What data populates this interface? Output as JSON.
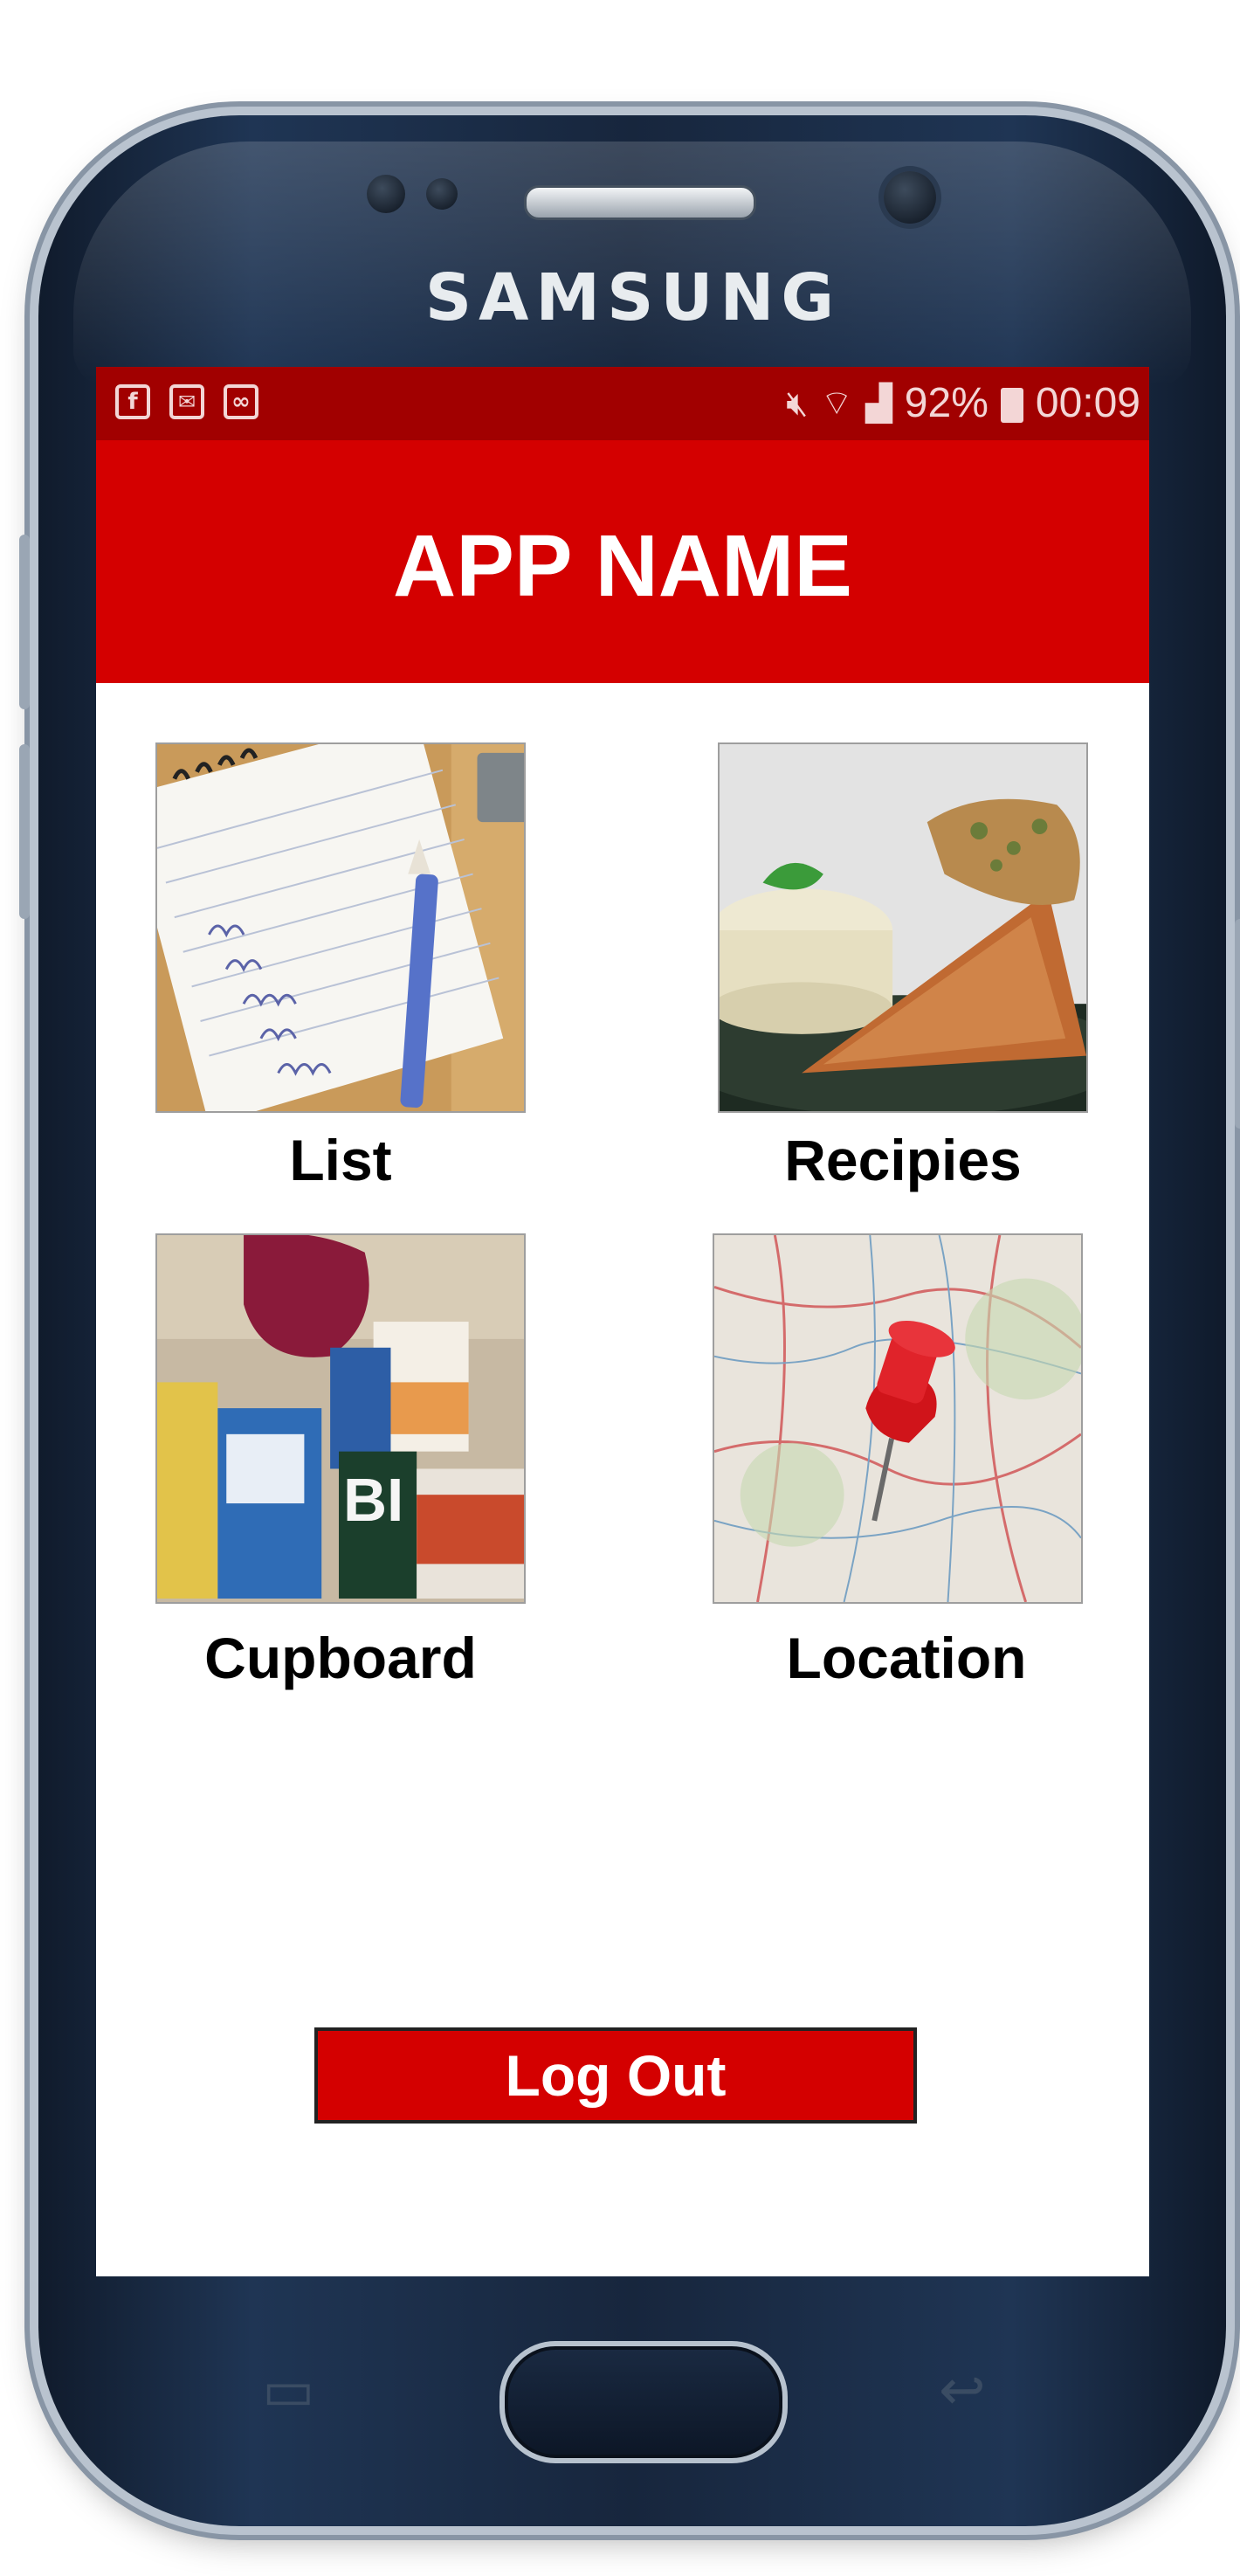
{
  "device": {
    "brand": "SAMSUNG"
  },
  "statusbar": {
    "left_icons": [
      {
        "icon": "facebook-icon",
        "glyph": "f"
      },
      {
        "icon": "mail-icon",
        "glyph": "✉"
      },
      {
        "icon": "voicemail-icon",
        "glyph": "∞"
      }
    ],
    "battery": "92%",
    "time": "00:09"
  },
  "appbar": {
    "title": "APP NAME"
  },
  "tiles": [
    {
      "label": "List",
      "image": "shopping-list-image"
    },
    {
      "label": "Recipies",
      "image": "recipe-food-image"
    },
    {
      "label": "Cupboard",
      "image": "cupboard-image"
    },
    {
      "label": "Location",
      "image": "map-pin-image"
    }
  ],
  "logout": {
    "label": "Log Out"
  },
  "colors": {
    "status_bar": "#a10000",
    "app_bar": "#d40000",
    "button": "#d40000"
  }
}
